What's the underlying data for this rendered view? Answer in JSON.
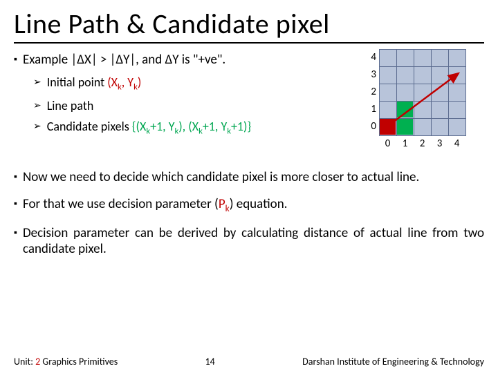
{
  "title": "Line Path & Candidate pixel",
  "bullets": {
    "example": "Example |ΔX| > |ΔY|, and ΔY is \"+ve\".",
    "sub1_prefix": "Initial point ",
    "sub1_coord": "(X",
    "sub1_coord_k": "k",
    "sub1_coord_mid": ", Y",
    "sub1_coord_k2": "k",
    "sub1_coord_end": ")",
    "sub2": "Line path",
    "sub3_prefix": "Candidate pixels ",
    "sub3_set": "{(X",
    "sub3_a": "k",
    "sub3_b": "+1, Y",
    "sub3_c": "k",
    "sub3_d": "), (X",
    "sub3_e": "k",
    "sub3_f": "+1, Y",
    "sub3_g": "k",
    "sub3_h": "+1)}",
    "now": "Now we need to decide which candidate pixel is more closer to actual line.",
    "forthat_a": "For that we use decision parameter (",
    "forthat_pk": "P",
    "forthat_k": "k",
    "forthat_b": ") equation.",
    "decision": "Decision parameter can be derived by calculating distance of actual line from two candidate pixel."
  },
  "grid": {
    "y": [
      "4",
      "3",
      "2",
      "1",
      "0"
    ],
    "x": [
      "0",
      "1",
      "2",
      "3",
      "4"
    ]
  },
  "footer": {
    "unit_label": "Unit: ",
    "unit_num": "2",
    "unit_name": " Graphics Primitives",
    "page": "14",
    "org": "Darshan Institute of Engineering & Technology"
  },
  "glyphs": {
    "square": "▪",
    "tri": "➢"
  }
}
